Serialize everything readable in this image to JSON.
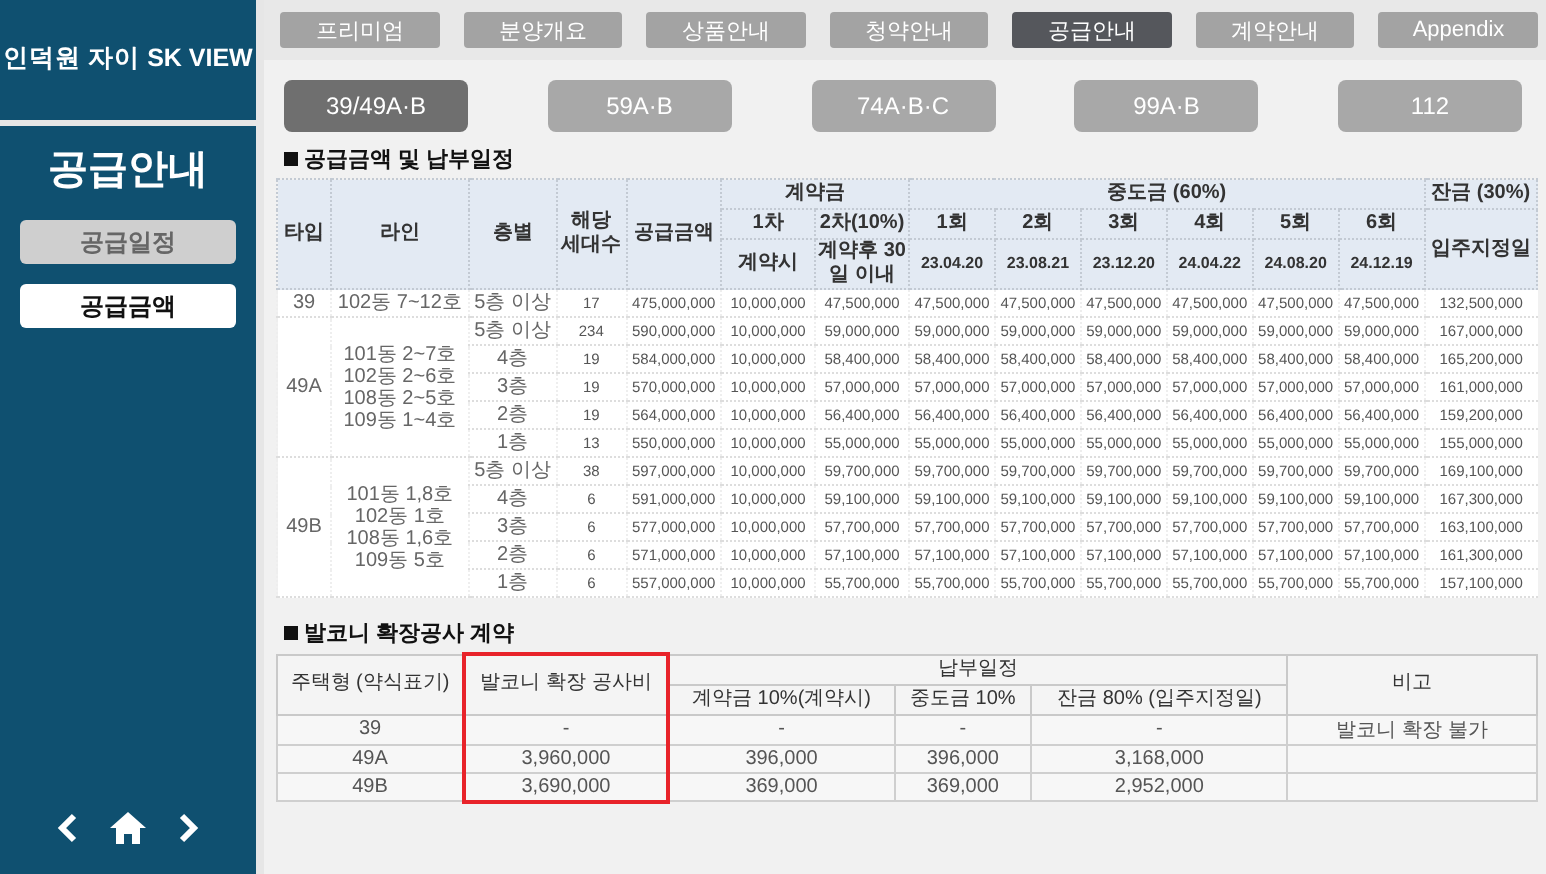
{
  "sidebar": {
    "brand": "인덕원 자이 SK VIEW",
    "title": "공급안내",
    "items": [
      {
        "label": "공급일정",
        "selected": false
      },
      {
        "label": "공급금액",
        "selected": true
      }
    ]
  },
  "nav_tabs": [
    {
      "label": "프리미엄",
      "selected": false
    },
    {
      "label": "분양개요",
      "selected": false
    },
    {
      "label": "상품안내",
      "selected": false
    },
    {
      "label": "청약안내",
      "selected": false
    },
    {
      "label": "공급안내",
      "selected": true
    },
    {
      "label": "계약안내",
      "selected": false
    },
    {
      "label": "Appendix",
      "selected": false
    }
  ],
  "unit_types": [
    {
      "label": "39/49A·B",
      "selected": true
    },
    {
      "label": "59A·B",
      "selected": false
    },
    {
      "label": "74A·B·C",
      "selected": false
    },
    {
      "label": "99A·B",
      "selected": false
    },
    {
      "label": "112",
      "selected": false
    }
  ],
  "supply_table": {
    "title": "공급금액 및 납부일정",
    "columns": {
      "type": "타입",
      "line": "라인",
      "floor": "층별",
      "units": "해당 세대수",
      "price": "공급금액"
    },
    "contract": {
      "label": "계약금",
      "subs": [
        {
          "round": "1차",
          "date": "계약시"
        },
        {
          "round": "2차(10%)",
          "date": "계약후 30일 이내"
        }
      ]
    },
    "middle": {
      "label": "중도금 (60%)",
      "subs": [
        {
          "round": "1회",
          "date": "23.04.20"
        },
        {
          "round": "2회",
          "date": "23.08.21"
        },
        {
          "round": "3회",
          "date": "23.12.20"
        },
        {
          "round": "4회",
          "date": "24.04.22"
        },
        {
          "round": "5회",
          "date": "24.08.20"
        },
        {
          "round": "6회",
          "date": "24.12.19"
        }
      ]
    },
    "balance": {
      "label": "잔금 (30%)",
      "date": "입주지정일"
    },
    "groups": [
      {
        "type": "39",
        "line": [
          "102동 7~12호"
        ],
        "rows": [
          {
            "floor": "5층 이상",
            "units": "17",
            "price": "475,000,000",
            "amounts": [
              "10,000,000",
              "47,500,000",
              "47,500,000",
              "47,500,000",
              "47,500,000",
              "47,500,000",
              "47,500,000",
              "47,500,000",
              "132,500,000"
            ]
          }
        ]
      },
      {
        "type": "49A",
        "line": [
          "101동 2~7호",
          "102동 2~6호",
          "108동 2~5호",
          "109동 1~4호"
        ],
        "rows": [
          {
            "floor": "5층 이상",
            "units": "234",
            "price": "590,000,000",
            "amounts": [
              "10,000,000",
              "59,000,000",
              "59,000,000",
              "59,000,000",
              "59,000,000",
              "59,000,000",
              "59,000,000",
              "59,000,000",
              "167,000,000"
            ]
          },
          {
            "floor": "4층",
            "units": "19",
            "price": "584,000,000",
            "amounts": [
              "10,000,000",
              "58,400,000",
              "58,400,000",
              "58,400,000",
              "58,400,000",
              "58,400,000",
              "58,400,000",
              "58,400,000",
              "165,200,000"
            ]
          },
          {
            "floor": "3층",
            "units": "19",
            "price": "570,000,000",
            "amounts": [
              "10,000,000",
              "57,000,000",
              "57,000,000",
              "57,000,000",
              "57,000,000",
              "57,000,000",
              "57,000,000",
              "57,000,000",
              "161,000,000"
            ]
          },
          {
            "floor": "2층",
            "units": "19",
            "price": "564,000,000",
            "amounts": [
              "10,000,000",
              "56,400,000",
              "56,400,000",
              "56,400,000",
              "56,400,000",
              "56,400,000",
              "56,400,000",
              "56,400,000",
              "159,200,000"
            ]
          },
          {
            "floor": "1층",
            "units": "13",
            "price": "550,000,000",
            "amounts": [
              "10,000,000",
              "55,000,000",
              "55,000,000",
              "55,000,000",
              "55,000,000",
              "55,000,000",
              "55,000,000",
              "55,000,000",
              "155,000,000"
            ]
          }
        ]
      },
      {
        "type": "49B",
        "line": [
          "101동 1,8호",
          "102동 1호",
          "108동 1,6호",
          "109동 5호"
        ],
        "rows": [
          {
            "floor": "5층 이상",
            "units": "38",
            "price": "597,000,000",
            "amounts": [
              "10,000,000",
              "59,700,000",
              "59,700,000",
              "59,700,000",
              "59,700,000",
              "59,700,000",
              "59,700,000",
              "59,700,000",
              "169,100,000"
            ]
          },
          {
            "floor": "4층",
            "units": "6",
            "price": "591,000,000",
            "amounts": [
              "10,000,000",
              "59,100,000",
              "59,100,000",
              "59,100,000",
              "59,100,000",
              "59,100,000",
              "59,100,000",
              "59,100,000",
              "167,300,000"
            ]
          },
          {
            "floor": "3층",
            "units": "6",
            "price": "577,000,000",
            "amounts": [
              "10,000,000",
              "57,700,000",
              "57,700,000",
              "57,700,000",
              "57,700,000",
              "57,700,000",
              "57,700,000",
              "57,700,000",
              "163,100,000"
            ]
          },
          {
            "floor": "2층",
            "units": "6",
            "price": "571,000,000",
            "amounts": [
              "10,000,000",
              "57,100,000",
              "57,100,000",
              "57,100,000",
              "57,100,000",
              "57,100,000",
              "57,100,000",
              "57,100,000",
              "161,300,000"
            ]
          },
          {
            "floor": "1층",
            "units": "6",
            "price": "557,000,000",
            "amounts": [
              "10,000,000",
              "55,700,000",
              "55,700,000",
              "55,700,000",
              "55,700,000",
              "55,700,000",
              "55,700,000",
              "55,700,000",
              "157,100,000"
            ]
          }
        ]
      }
    ]
  },
  "balcony_table": {
    "title": "발코니 확장공사 계약",
    "type_column": "주택형 (약식표기)",
    "cost_column": {
      "label": "발코니 확장 공사비",
      "highlighted": true
    },
    "schedule": {
      "label": "납부일정",
      "subs": [
        "계약금 10%(계약시)",
        "중도금 10%",
        "잔금 80% (입주지정일)"
      ]
    },
    "note_column": "비고",
    "rows": [
      {
        "type": "39",
        "cost": "-",
        "payments": [
          "-",
          "-",
          "-"
        ],
        "note": "발코니 확장 불가"
      },
      {
        "type": "49A",
        "cost": "3,960,000",
        "payments": [
          "396,000",
          "396,000",
          "3,168,000"
        ]
      },
      {
        "type": "49B",
        "cost": "3,690,000",
        "payments": [
          "369,000",
          "369,000",
          "2,952,000"
        ]
      }
    ]
  }
}
